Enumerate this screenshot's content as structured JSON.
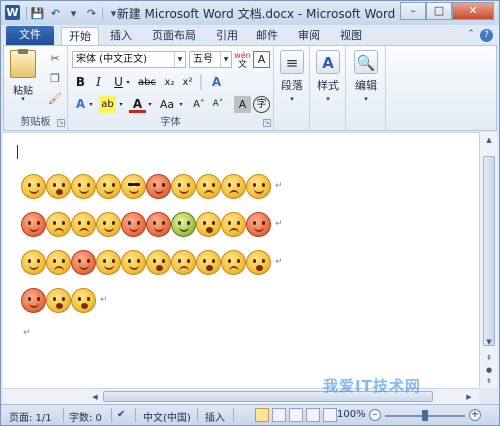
{
  "app": {
    "title": "新建 Microsoft Word 文档.docx - Microsoft Word",
    "logo_letter": "W"
  },
  "window_controls": {
    "minimize": "–",
    "maximize": "□",
    "close": "✕"
  },
  "quick_access": {
    "save": "💾",
    "undo": "↶",
    "redo": "↷",
    "customize": "▾"
  },
  "tabs": {
    "file": "文件",
    "items": [
      "开始",
      "插入",
      "页面布局",
      "引用",
      "邮件",
      "审阅",
      "视图"
    ],
    "active": "开始"
  },
  "ribbon": {
    "clipboard": {
      "paste": "粘贴",
      "group_label": "剪贴板"
    },
    "font": {
      "font_name": "宋体 (中文正文)",
      "font_size": "五号",
      "wen": "wén",
      "group_label": "字体",
      "bold": "B",
      "italic": "I",
      "underline": "U",
      "strike": "abc",
      "sub": "x₂",
      "sup": "x²",
      "grow": "A˄",
      "shrink": "A˅",
      "case": "Aa",
      "clear": "A",
      "color": "A",
      "highlight": "ab",
      "char_border": "A",
      "enclosed": "字",
      "aa_effect": "A",
      "phonetic": "文"
    },
    "paragraph": {
      "label": "段落"
    },
    "styles": {
      "label": "样式"
    },
    "editing": {
      "label": "编辑"
    }
  },
  "document": {
    "emoji_rows": [
      [
        "smile",
        "grin",
        "tongue",
        "smile",
        "cool",
        "angry",
        "smile",
        "sad",
        "cry",
        "smile"
      ],
      [
        "angry",
        "sad",
        "sad",
        "smile",
        "angry",
        "red",
        "green",
        "open",
        "sad",
        "red"
      ],
      [
        "smile",
        "sad",
        "angry",
        "smile",
        "smile",
        "grin",
        "sad",
        "open",
        "sad",
        "open"
      ],
      [
        "red",
        "open",
        "open"
      ]
    ]
  },
  "status": {
    "page": "页面: 1/1",
    "words": "字数: 0",
    "language": "中文(中国)",
    "insert": "插入",
    "zoom": "100%",
    "zoom_fraction": 0.5
  },
  "watermark": "我爱IT技术网"
}
